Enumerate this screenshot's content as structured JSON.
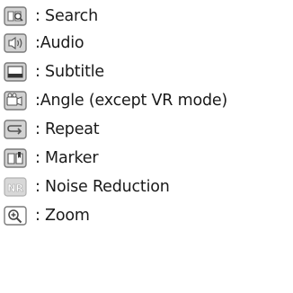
{
  "legend": {
    "items": [
      {
        "icon": "search-icon",
        "label": ": Search"
      },
      {
        "icon": "audio-icon",
        "label": ":Audio"
      },
      {
        "icon": "subtitle-icon",
        "label": ": Subtitle"
      },
      {
        "icon": "angle-icon",
        "label": ":Angle (except VR mode)"
      },
      {
        "icon": "repeat-icon",
        "label": ": Repeat"
      },
      {
        "icon": "marker-icon",
        "label": ": Marker"
      },
      {
        "icon": "noise-reduction-icon",
        "label": ": Noise Reduction",
        "icon_text": "NR"
      },
      {
        "icon": "zoom-icon",
        "label": ": Zoom"
      }
    ]
  },
  "colors": {
    "icon_stroke": "#7a7a7a",
    "icon_fill": "#d2d2d2",
    "icon_dark": "#555555",
    "text": "#1a1a1a"
  }
}
